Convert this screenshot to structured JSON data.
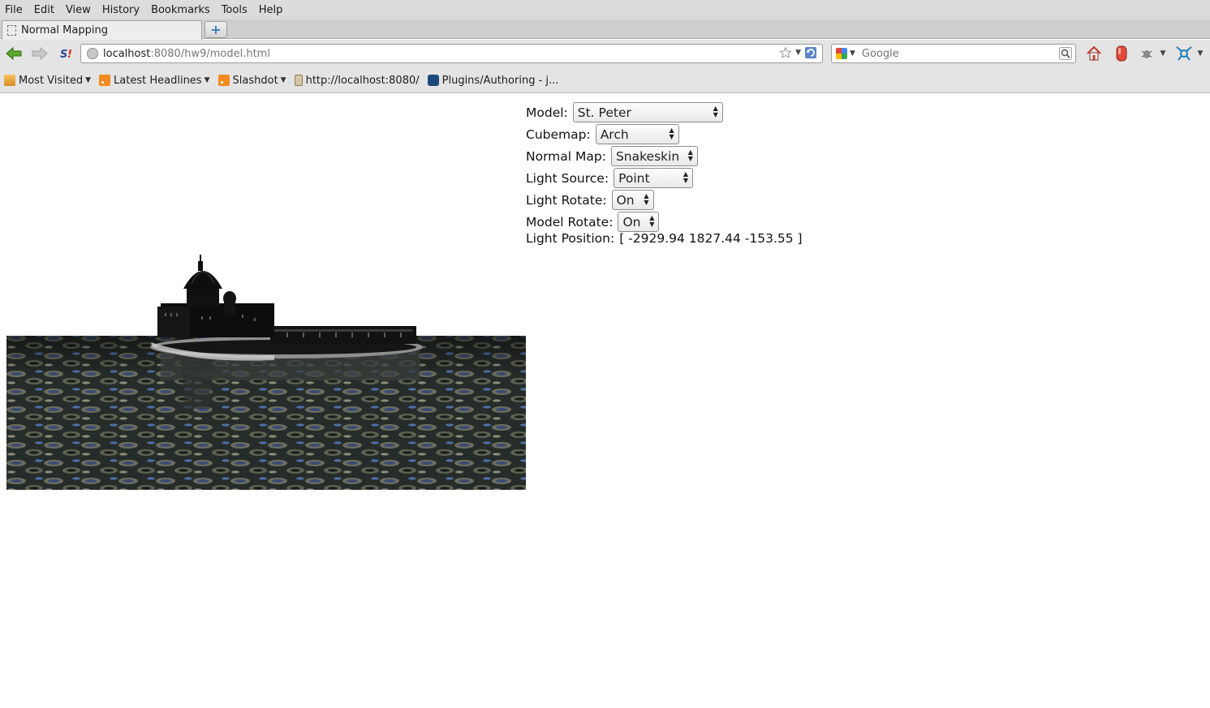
{
  "menu": {
    "file": "File",
    "edit": "Edit",
    "view": "View",
    "history": "History",
    "bookmarks": "Bookmarks",
    "tools": "Tools",
    "help": "Help"
  },
  "tab": {
    "title": "Normal Mapping"
  },
  "nav": {
    "url_host": "localhost",
    "url_path": ":8080/hw9/model.html",
    "search_placeholder": "Google"
  },
  "bookmarks": [
    {
      "label": "Most Visited",
      "icon": "folder-icon",
      "dropdown": true
    },
    {
      "label": "Latest Headlines",
      "icon": "rss-icon",
      "dropdown": true
    },
    {
      "label": "Slashdot",
      "icon": "rss-icon",
      "dropdown": true
    },
    {
      "label": "http://localhost:8080/",
      "icon": "tag-icon",
      "dropdown": false
    },
    {
      "label": "Plugins/Authoring - j...",
      "icon": "blender-icon",
      "dropdown": false
    }
  ],
  "controls": {
    "model": {
      "label": "Model:",
      "value": "St. Peter"
    },
    "cubemap": {
      "label": "Cubemap:",
      "value": "Arch"
    },
    "normal_map": {
      "label": "Normal Map:",
      "value": "Snakeskin"
    },
    "light_source": {
      "label": "Light Source:",
      "value": "Point"
    },
    "light_rotate": {
      "label": "Light Rotate:",
      "value": "On"
    },
    "model_rotate": {
      "label": "Model Rotate:",
      "value": "On"
    },
    "light_position": {
      "label": "Light Position:",
      "value": "[ -2929.94 1827.44 -153.55 ]"
    }
  },
  "colors": {
    "chrome_bg": "#e4e4e4",
    "water_dark": "#1f2524",
    "water_light": "#6d7060",
    "water_blue": "#3f5f9a"
  }
}
